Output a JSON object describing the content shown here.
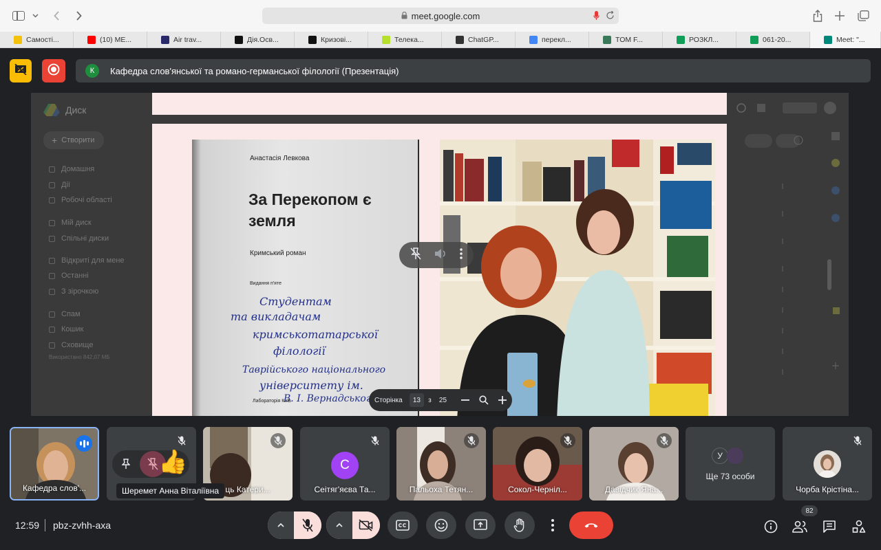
{
  "browser": {
    "url": "meet.google.com",
    "tabs": [
      {
        "label": "Самості...",
        "color": "#f4c20d"
      },
      {
        "label": "(10) ME...",
        "color": "#ff0000"
      },
      {
        "label": "Air trav...",
        "color": "#2a2a6a"
      },
      {
        "label": "Дія.Осв...",
        "color": "#111111"
      },
      {
        "label": "Кризові...",
        "color": "#111111"
      },
      {
        "label": "Телека...",
        "color": "#b6e02c"
      },
      {
        "label": "ChatGP...",
        "color": "#333333"
      },
      {
        "label": "перекл...",
        "color": "#4285f4"
      },
      {
        "label": "TOM F...",
        "color": "#3a7a5a"
      },
      {
        "label": "РОЗКЛ...",
        "color": "#0f9d58"
      },
      {
        "label": "061-20...",
        "color": "#0f9d58"
      },
      {
        "label": "Meet: \"...",
        "color": "#00897b"
      }
    ]
  },
  "meeting": {
    "title_initial": "К",
    "title": "Кафедра слов'янської та романо-германської філології (Презентація)",
    "clock": "12:59",
    "code": "pbz-zvhh-axa",
    "people_count": "82"
  },
  "drive": {
    "title": "Диск",
    "create": "Створити",
    "nav": [
      "Домашня",
      "Дії",
      "Робочі області",
      "Мій диск",
      "Спільні диски",
      "Відкриті для мене",
      "Останні",
      "З зірочкою",
      "Спам",
      "Кошик",
      "Сховище"
    ],
    "storage": "Використано 842,07 МБ"
  },
  "slide": {
    "book_author": "Анастасія Левкова",
    "book_title": "За Перекопом є земля",
    "book_subtitle": "Кримський роман",
    "book_edition": "Видання п'яте",
    "book_press": "Лабораторія Київ",
    "inscription": [
      "Студентам",
      "та викладачам",
      "кримськотатарської",
      "філології",
      "Таврійського національного",
      "університету ім.",
      "В. І. Вернадського"
    ]
  },
  "page_nav": {
    "label": "Сторінка",
    "current": "13",
    "of": "з",
    "total": "25"
  },
  "participants": [
    {
      "name": "Кафедра слов'..."
    },
    {
      "name": ""
    },
    {
      "name": "ць Катери..."
    },
    {
      "name": "Сеітяг'яєва Та...",
      "initial": "С"
    },
    {
      "name": "Пальоха Тетян..."
    },
    {
      "name": "Сокол-Черніл..."
    },
    {
      "name": "Давідчик Яна..."
    },
    {
      "name": "Ще 73 особи",
      "initial": "У"
    },
    {
      "name": "Чорба Крістіна..."
    }
  ],
  "hover": {
    "tooltip": "Шеремет Анна Віталіївна",
    "emoji": "👍"
  },
  "colors": {
    "accent": "#8ab4f8",
    "leave": "#ea4335",
    "muted_bg": "#f9dedc",
    "stop_share": "#fbbc04"
  }
}
